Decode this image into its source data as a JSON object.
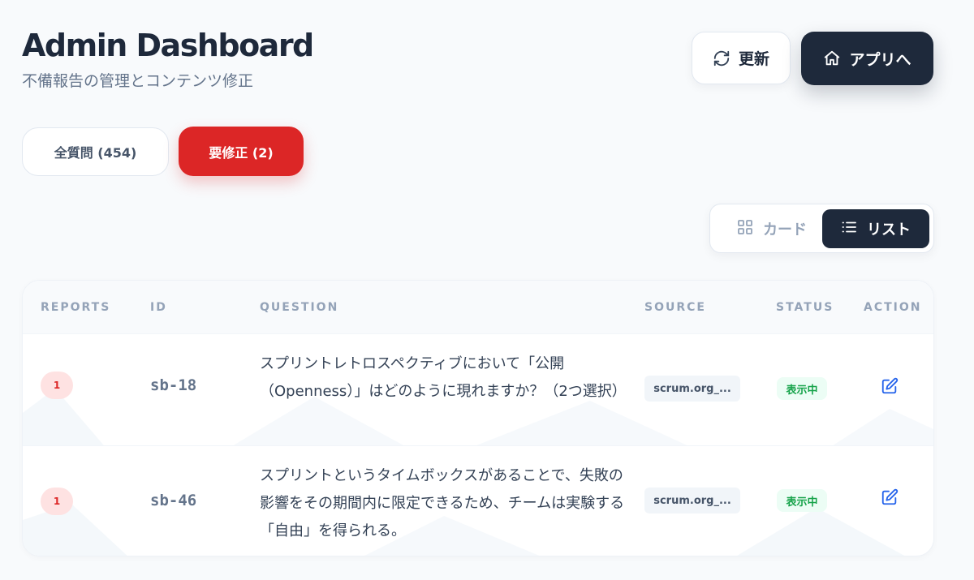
{
  "header": {
    "title": "Admin Dashboard",
    "subtitle": "不備報告の管理とコンテンツ修正",
    "refresh_label": "更新",
    "refresh_icon": "refresh-icon",
    "app_label": "アプリへ",
    "app_icon": "home-icon"
  },
  "filters": {
    "all_label": "全質問 (454)",
    "needs_fix_label": "要修正 (2)"
  },
  "view_toggle": {
    "card_label": "カード",
    "card_icon": "grid-icon",
    "list_label": "リスト",
    "list_icon": "list-icon",
    "selected": "リスト"
  },
  "table": {
    "columns": [
      "REPORTS",
      "ID",
      "QUESTION",
      "SOURCE",
      "STATUS",
      "ACTION"
    ],
    "rows": [
      {
        "reports": "1",
        "id": "sb-18",
        "question": "スプリントレトロスペクティブにおいて「公開（Openness）」はどのように現れますか？（2つ選択）",
        "source": "scrum.org_...",
        "status": "表示中"
      },
      {
        "reports": "1",
        "id": "sb-46",
        "question": "スプリントというタイムボックスがあることで、失敗の影響をその期間内に限定できるため、チームは実験する「自由」を得られる。",
        "source": "scrum.org_...",
        "status": "表示中"
      }
    ]
  },
  "colors": {
    "primary_dark": "#1e293b",
    "danger": "#dc2626",
    "success": "#16a34a",
    "edit_blue": "#2563eb",
    "background": "#f8fafc"
  }
}
